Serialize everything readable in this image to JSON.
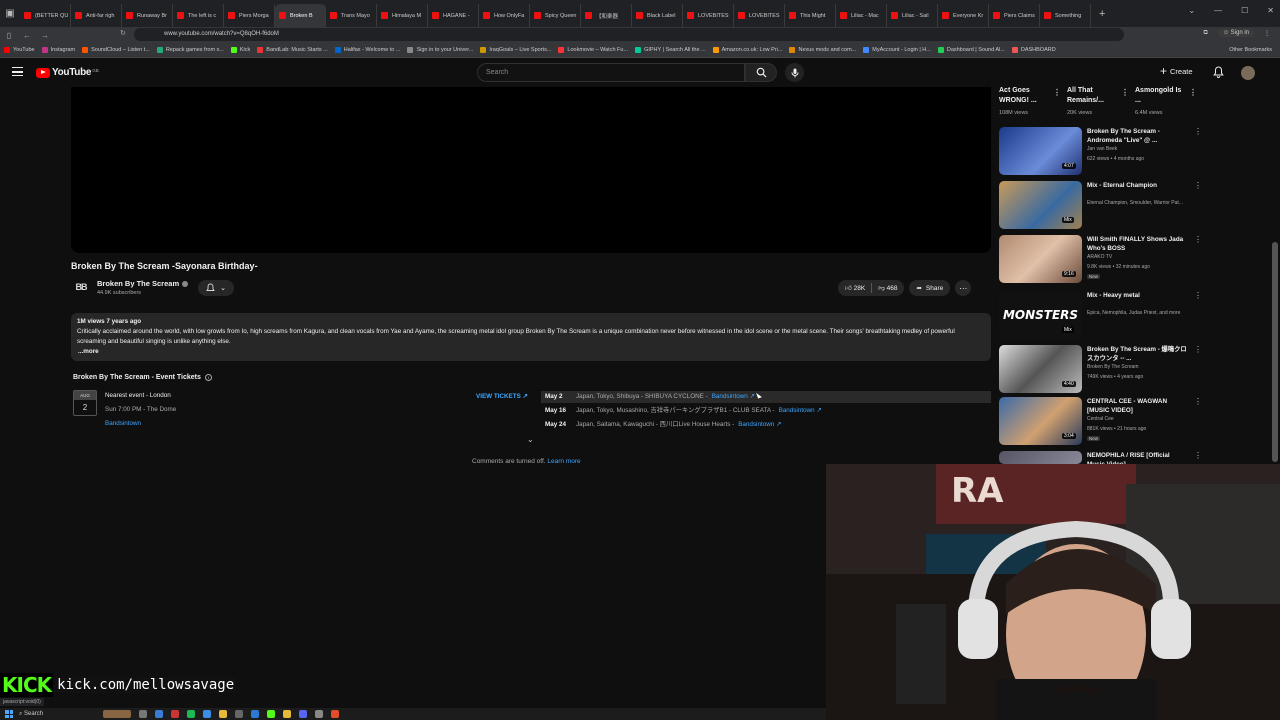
{
  "browser": {
    "tabs": [
      {
        "label": "(BETTER QU",
        "active": false
      },
      {
        "label": "Anti-far righ",
        "active": false
      },
      {
        "label": "Runaway Br",
        "active": false
      },
      {
        "label": "The left is c",
        "active": false
      },
      {
        "label": "Piers Morga",
        "active": false
      },
      {
        "label": "Broken B",
        "active": true
      },
      {
        "label": "Trans Mayo",
        "active": false
      },
      {
        "label": "Himalaya M",
        "active": false
      },
      {
        "label": "HAGANE -",
        "active": false
      },
      {
        "label": "How OnlyFa",
        "active": false
      },
      {
        "label": "Spicy Queen",
        "active": false
      },
      {
        "label": "【和楽器",
        "active": false
      },
      {
        "label": "Black Label",
        "active": false
      },
      {
        "label": "LOVEBITES",
        "active": false
      },
      {
        "label": "LOVEBITES",
        "active": false
      },
      {
        "label": "This Might",
        "active": false
      },
      {
        "label": "Liliac - Mac",
        "active": false
      },
      {
        "label": "Liliac - Sail",
        "active": false
      },
      {
        "label": "Everyone Kr",
        "active": false
      },
      {
        "label": "Piers Claims",
        "active": false
      },
      {
        "label": "Something",
        "active": false
      }
    ],
    "url": "www.youtube.com/watch?v=Q8qOH-f6doM",
    "signin": "Sign in",
    "bookmarks": [
      "YouTube",
      "Instagram",
      "SoundCloud – Listen t...",
      "Repack games from x...",
      "Kick",
      "BandLab: Music Starts ...",
      "Halifax - Welcome to ...",
      "Sign in to your Univer...",
      "IraqGoals – Live Sports...",
      "Lookmovie – Watch Fu...",
      "GIPHY | Search All the ...",
      "Amazon.co.uk: Low Pri...",
      "Nexus mods and com...",
      "MyAccount - Login | H...",
      "Dashboard | Sound Al...",
      "DASHBOARD"
    ],
    "other_bookmarks": "Other Bookmarks",
    "status_url": "javascript:void(0)"
  },
  "youtube": {
    "logo_text": "YouTube",
    "logo_region": "GB",
    "search_placeholder": "Search",
    "create_label": "Create"
  },
  "video": {
    "title": "Broken By The Scream -Sayonara Birthday-",
    "channel_name": "Broken By The Scream",
    "channel_initials": "BB",
    "subscribers": "44.9K subscribers",
    "likes": "28K",
    "dislikes": "468",
    "share": "Share",
    "description": {
      "meta": "1M views  7 years ago",
      "text": "Critically acclaimed around the world, with low growls from Io, high screams from Kagura, and clean vocals from Yae and Ayame, the screaming metal idol group Broken By The Scream is a unique combination never before witnessed in the idol scene or the metal scene. Their songs' breathtaking medley of powerful screaming and beautiful singing is unlike anything else.",
      "more": "...more"
    }
  },
  "events": {
    "title": "Broken By The Scream - Event Tickets",
    "date_month": "AUG",
    "date_day": "2",
    "nearest": "Nearest event - London",
    "time_place": "Sun 7:00 PM - The Dome",
    "provider": "Bandsintown",
    "view_tickets": "VIEW TICKETS ↗",
    "list": [
      {
        "date": "May 2",
        "location": "Japan, Tokyo, Shibuya - SHIBUYA CYCLONE -",
        "link": "Bandsintown ↗"
      },
      {
        "date": "May 16",
        "location": "Japan, Tokyo, Musashino, 吉祥寺パーキングプラザB1 - CLUB SEATA -",
        "link": "Bandsintown ↗"
      },
      {
        "date": "May 24",
        "location": "Japan, Saitama, Kawaguchi - 西川口Live House Hearts -",
        "link": "Bandsintown ↗"
      }
    ]
  },
  "comments": {
    "text": "Comments are turned off.",
    "learn_more": "Learn more"
  },
  "shorts": [
    {
      "title": "Act Goes WRONG! ...",
      "views": "108M views"
    },
    {
      "title": "All That Remains/...",
      "views": "20K views"
    },
    {
      "title": "Asmongold Is ...",
      "views": "6.4M views"
    }
  ],
  "recommendations": [
    {
      "title": "Broken By The Scream - Andromeda \"Live\" @ ...",
      "channel": "Jan van Beek",
      "meta": "622 views • 4 months ago",
      "duration": "4:07",
      "badge": ""
    },
    {
      "title": "Mix - Eternal Champion",
      "channel": "Eternal Champion, Smoulder, Warrior Pat...",
      "meta": "",
      "duration": "Mix",
      "badge": ""
    },
    {
      "title": "Will Smith FINALLY Shows Jada Who's BOSS",
      "channel": "ARAKO TV",
      "meta": "9.8K views • 32 minutes ago",
      "duration": "9:16",
      "badge": "New"
    },
    {
      "title": "Mix - Heavy metal",
      "channel": "Epica, Nemophila, Judas Priest, and more",
      "meta": "",
      "duration": "Mix",
      "badge": "",
      "thumb_text": "MONSTERS"
    },
    {
      "title": "Broken By The Scream - 爆鳴クロスカウンタ -- ...",
      "channel": "Broken By The Scream",
      "meta": "749K views • 4 years ago",
      "duration": "4:40",
      "badge": ""
    },
    {
      "title": "CENTRAL CEE - WAGWAN [MUSIC VIDEO]",
      "channel": "Central Cee",
      "meta": "881K views • 21 hours ago",
      "duration": "3:04",
      "badge": "New"
    },
    {
      "title": "NEMOPHILA / RISE [Official Music Video]",
      "channel": "",
      "meta": "",
      "duration": "",
      "badge": ""
    }
  ],
  "overlay": {
    "kick_logo": "KICK",
    "kick_url": "kick.com/mellowsavage"
  },
  "taskbar": {
    "search": "Search"
  },
  "colors": {
    "youtube_red": "#ff0000",
    "link_blue": "#3ea6ff",
    "kick_green": "#53fc18"
  }
}
